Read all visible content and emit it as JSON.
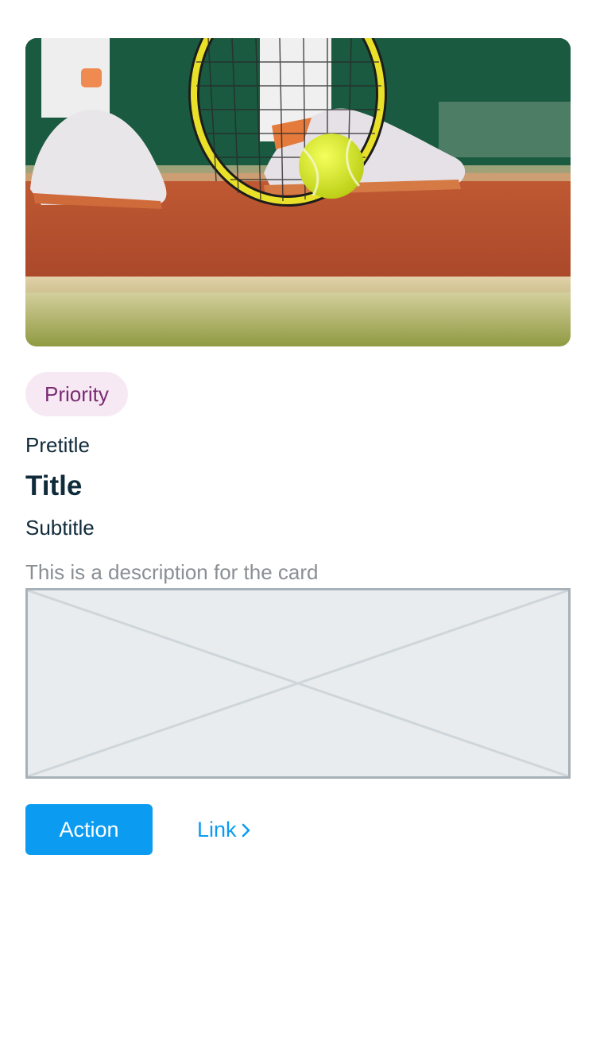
{
  "card": {
    "image_alt": "Tennis player with racket and ball on clay court",
    "badge": "Priority",
    "pretitle": "Pretitle",
    "title": "Title",
    "subtitle": "Subtitle",
    "description": "This is a description for the card",
    "action_label": "Action",
    "link_label": "Link",
    "link_icon": "chevron-right-icon"
  },
  "colors": {
    "accent": "#0b9cf2",
    "badge_bg": "#f6e9f3",
    "badge_text": "#7a2a73",
    "heading_text": "#0f2a3a",
    "muted_text": "#8a8f94",
    "placeholder_bg": "#e8ecee",
    "placeholder_border": "#a7b1b8"
  }
}
